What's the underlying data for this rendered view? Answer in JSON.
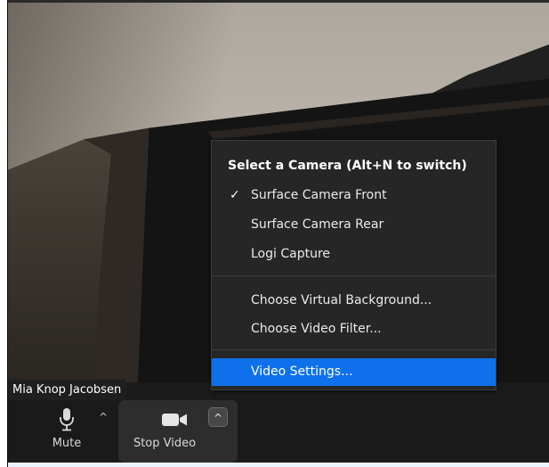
{
  "menu": {
    "header": "Select a Camera (Alt+N to switch)",
    "check_mark": "✓",
    "cameras": [
      {
        "label": "Surface Camera Front",
        "checked": true
      },
      {
        "label": "Surface Camera Rear",
        "checked": false
      },
      {
        "label": "Logi Capture",
        "checked": false
      }
    ],
    "options": [
      {
        "label": "Choose Virtual Background..."
      },
      {
        "label": "Choose Video Filter..."
      }
    ],
    "settings": {
      "label": "Video Settings...",
      "highlighted": true
    }
  },
  "participant": {
    "name": "Mia Knop Jacobsen"
  },
  "toolbar": {
    "mute_label": "Mute",
    "stop_video_label": "Stop Video",
    "caret": "^"
  },
  "colors": {
    "highlight": "#0e71eb",
    "menu_bg": "#262626",
    "toolbar_bg": "#1a1a1a"
  }
}
